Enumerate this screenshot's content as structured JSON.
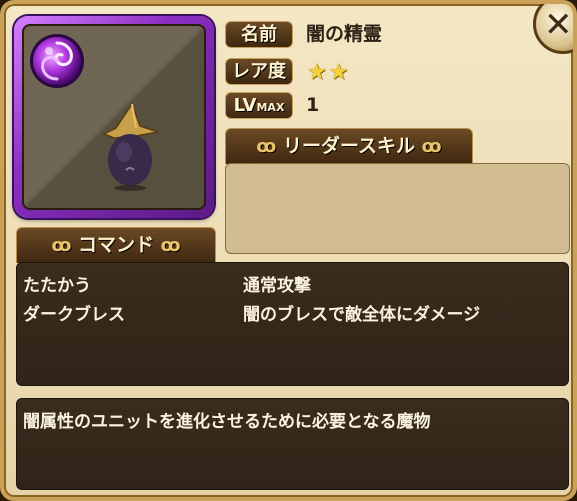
{
  "monster": {
    "name_label": "名前",
    "name": "闇の精霊",
    "rarity_label": "レア度",
    "rarity_stars": 2,
    "level_label": "LV",
    "level_label_sub": "MAX",
    "level": "1",
    "element": "dark",
    "element_icon": "dark-element-orb-icon"
  },
  "leader_skill": {
    "header": "リーダースキル",
    "text": ""
  },
  "commands": {
    "header": "コマンド",
    "rows": [
      {
        "name": "たたかう",
        "desc": "通常攻撃"
      },
      {
        "name": "ダークブレス",
        "desc": "闇のブレスで敵全体にダメージ"
      }
    ]
  },
  "description": "闇属性のユニットを進化させるために必要となる魔物",
  "colors": {
    "frame": "#ecdcb4",
    "portrait_border": "#8a2ec0",
    "dark_panel": "#2f2418",
    "star": "#f6d23a"
  }
}
